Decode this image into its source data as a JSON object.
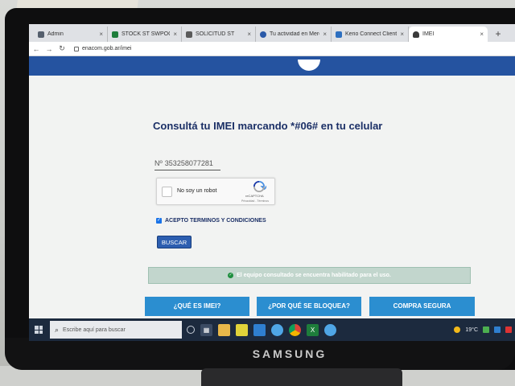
{
  "browser": {
    "tabs": [
      {
        "label": "Admin",
        "favicon_color": "#555f6d",
        "active": false
      },
      {
        "label": "STOCK ST SWPOCENT",
        "favicon_color": "#1e7d3b",
        "active": false
      },
      {
        "label": "SOLICITUD ST",
        "favicon_color": "#5a5a5a",
        "active": false
      },
      {
        "label": "Tu actividad en Merc",
        "favicon_color": "#2a59a8",
        "active": false
      },
      {
        "label": "Kerio Connect Client",
        "favicon_color": "#2d6fc0",
        "active": false
      },
      {
        "label": "IMEI",
        "favicon_color": "#3b3b3b",
        "active": true
      }
    ],
    "tab_close_glyph": "×",
    "new_tab_glyph": "+",
    "url": "enacom.gob.ar/imei"
  },
  "page": {
    "headline": "Consultá tu IMEI marcando *#06# en tu celular",
    "imei_prefix": "Nº",
    "imei_value": "353258077281",
    "captcha": {
      "label": "No soy un robot",
      "brand": "reCAPTCHA",
      "links": "Privacidad - Términos"
    },
    "terms_label": "ACEPTO TERMINOS Y CONDICIONES",
    "terms_checked": true,
    "buscar_label": "BUSCAR",
    "status_message": "El equipo consultado se encuentra habilitado para el uso.",
    "cta_buttons": [
      {
        "label": "¿QUÉ ES IMEI?"
      },
      {
        "label": "¿POR QUÉ SE BLOQUEA?"
      },
      {
        "label": "COMPRA SEGURA"
      }
    ],
    "colors": {
      "header": "#2553a0",
      "headline": "#1b2f66",
      "cta": "#2b8ed0",
      "status_bg": "#c2d6cd"
    }
  },
  "taskbar": {
    "search_placeholder": "Escribe aquí para buscar",
    "icons": [
      "task-view-icon",
      "cortana-icon",
      "file-explorer-icon",
      "sticky-notes-icon",
      "app-icon",
      "edge-icon",
      "chrome-icon",
      "excel-icon",
      "edge-icon-2"
    ],
    "temperature": "19°C"
  },
  "monitor": {
    "brand": "SAMSUNG"
  }
}
